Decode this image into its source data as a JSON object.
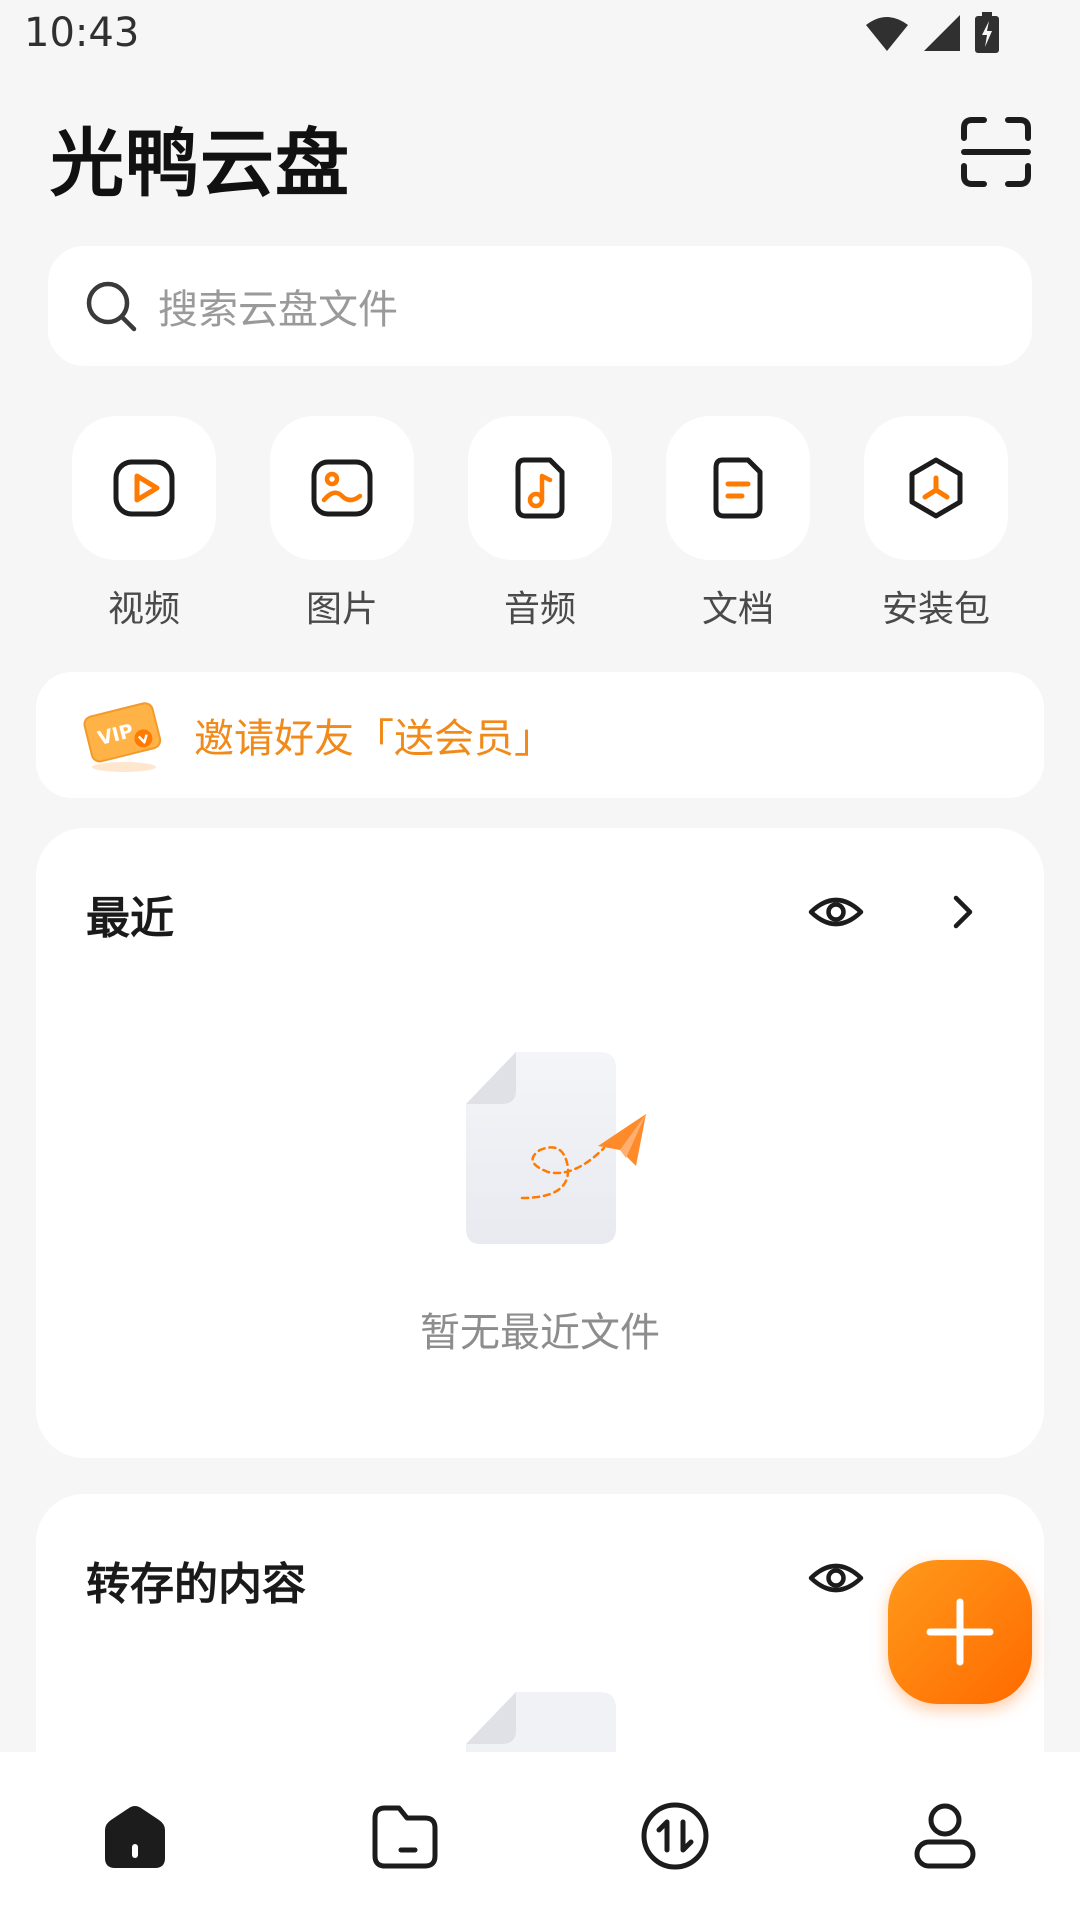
{
  "status_bar": {
    "time": "10:43"
  },
  "header": {
    "title": "光鸭云盘"
  },
  "search": {
    "placeholder": "搜索云盘文件"
  },
  "categories": [
    {
      "label": "视频",
      "icon": "video-icon"
    },
    {
      "label": "图片",
      "icon": "image-icon"
    },
    {
      "label": "音频",
      "icon": "audio-icon"
    },
    {
      "label": "文档",
      "icon": "document-icon"
    },
    {
      "label": "安装包",
      "icon": "package-icon"
    }
  ],
  "invite": {
    "text": "邀请好友「送会员」",
    "badge_text": "VIP"
  },
  "recent": {
    "title": "最近",
    "empty_text": "暂无最近文件"
  },
  "saved": {
    "title": "转存的内容"
  },
  "nav": [
    {
      "icon": "home-icon",
      "active": true
    },
    {
      "icon": "folder-icon",
      "active": false
    },
    {
      "icon": "transfer-icon",
      "active": false
    },
    {
      "icon": "profile-icon",
      "active": false
    }
  ],
  "colors": {
    "accent": "#ff7a00",
    "banner_text": "#f08a1a",
    "background": "#f6f6f6"
  }
}
